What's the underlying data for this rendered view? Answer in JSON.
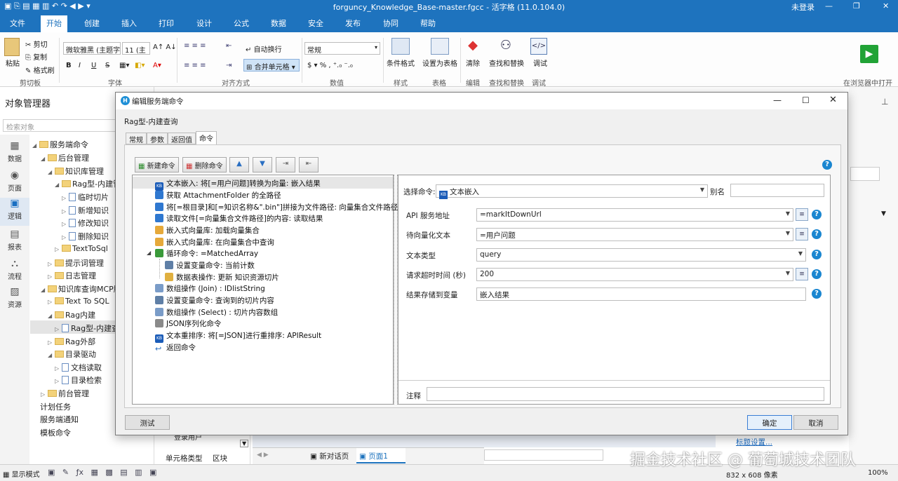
{
  "window": {
    "title": "forguncy_Knowledge_Base-master.fgcc - 活字格 (11.0.104.0)",
    "login": "未登录"
  },
  "menu": [
    "文件",
    "开始",
    "创建",
    "插入",
    "打印",
    "设计",
    "公式",
    "数据",
    "安全",
    "发布",
    "协同",
    "帮助"
  ],
  "ribbon": {
    "clipboard": {
      "paste": "粘贴",
      "cut": "剪切",
      "copy": "复制",
      "format": "格式刷",
      "group": "剪切板"
    },
    "font": {
      "family": "微软雅黑 (主题字",
      "size": "11 (主",
      "group": "字体"
    },
    "align": {
      "wrap": "自动换行",
      "merge": "合并单元格",
      "group": "对齐方式"
    },
    "number": {
      "format": "常规",
      "group": "数值"
    },
    "style": {
      "cond": "条件格式",
      "group": "样式"
    },
    "table": {
      "set": "设置为表格",
      "group": "表格"
    },
    "edit": {
      "clear": "清除",
      "group": "编辑"
    },
    "find": {
      "label": "查找和替换",
      "group": "查找和替换"
    },
    "debug": {
      "label": "调试",
      "group": "调试"
    },
    "browser": "在浏览器中打开"
  },
  "left": {
    "title": "对象管理器",
    "search": "检索对象",
    "iconbar": [
      "数据",
      "页面",
      "逻辑",
      "报表",
      "流程",
      "资源"
    ],
    "tree": [
      "服务端命令",
      "后台管理",
      "知识库管理",
      "Rag型-内建管",
      "临时切片",
      "新增知识",
      "修改知识",
      "删除知识",
      "TextToSql",
      "提示词管理",
      "日志管理",
      "知识库查询MCP服",
      "Text To SQL",
      "Rag内建",
      "Rag型-内建查",
      "Rag外部",
      "目录驱动",
      "文档读取",
      "目录检索",
      "前台管理",
      "计划任务",
      "服务端通知",
      "模板命令"
    ]
  },
  "dialog": {
    "title": "编辑服务端命令",
    "name": "Rag型-内建查询",
    "tabs": [
      "常规",
      "参数",
      "返回值",
      "命令"
    ],
    "toolbar": {
      "new": "新建命令",
      "delete": "删除命令"
    },
    "commands": [
      "文本嵌入: 将[=用户问题]转换为向量: 嵌入结果",
      "获取 AttachmentFolder 的全路径",
      "将[=根目录]和[=知识名称&\".bin\"]拼接为文件路径: 向量集合文件路径",
      "读取文件[=向量集合文件路径]的内容: 读取结果",
      "嵌入式向量库: 加载向量集合",
      "嵌入式向量库: 在向量集合中查询",
      "循环命令: =MatchedArray",
      "设置变量命令: 当前计数",
      "数据表操作: 更新 知识资源切片",
      "数组操作 (Join) : IDlistString",
      "设置变量命令: 查询到的切片内容",
      "数组操作 (Select) : 切片内容数组",
      "JSON序列化命令",
      "文本重排序: 将[=JSON]进行重排序: APIResult",
      "返回命令"
    ],
    "props": {
      "select_label": "选择命令:",
      "select_value": "文本嵌入",
      "alias_label": "别名",
      "rows": [
        {
          "label": "API 服务地址",
          "value": "=markItDownUrl"
        },
        {
          "label": "待向量化文本",
          "value": "=用户问题"
        },
        {
          "label": "文本类型",
          "value": "query"
        },
        {
          "label": "请求超时时间 (秒)",
          "value": "200"
        },
        {
          "label": "结果存储到变量",
          "value": "嵌入结果"
        }
      ],
      "note_label": "注释"
    },
    "buttons": {
      "test": "测试",
      "ok": "确定",
      "cancel": "取消"
    }
  },
  "bottom": {
    "tabs": [
      "新对话页",
      "页面1"
    ],
    "cell_type": "单元格类型",
    "block": "区块",
    "login_user": "登录用户",
    "title_setting": "标题设置..."
  },
  "status": {
    "mode": "显示模式",
    "size": "832 x 608 像素",
    "zoom": "100%"
  },
  "watermark": "掘金技术社区 @ 葡萄城技术团队"
}
